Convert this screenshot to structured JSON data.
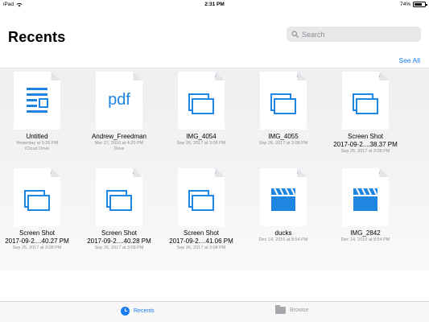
{
  "status_bar": {
    "device": "iPad",
    "time": "2:31 PM",
    "battery": "74%",
    "battery_level": 0.74
  },
  "header": {
    "title": "Recents",
    "search_placeholder": "Search",
    "see_all": "See All"
  },
  "colors": {
    "accent": "#1a7cf4",
    "icon_blue": "#1e86e0",
    "meta_gray": "#8e8e93"
  },
  "files": [
    {
      "name": "Untitled",
      "meta": "Yesterday at 5:26 PM",
      "meta2": "iCloud Drive",
      "icon": "document-icon",
      "cloud": false
    },
    {
      "name": "Andrew_Freedman",
      "meta": "Mar 27, 2016 at 4:20 PM",
      "meta2": "Drive",
      "icon": "pdf-icon",
      "pdf_label": "pdf",
      "cloud": false
    },
    {
      "name": "IMG_4054",
      "meta": "Sep 26, 2017 at 3:08 PM",
      "meta2": "",
      "icon": "image-stack-icon",
      "cloud": true
    },
    {
      "name": "IMG_4055",
      "meta": "Sep 26, 2017 at 3:08 PM",
      "meta2": "",
      "icon": "image-stack-icon",
      "cloud": true
    },
    {
      "name": "Screen Shot",
      "name2": "2017-09-2....38.37 PM",
      "meta": "Sep 26, 2017 at 3:08 PM",
      "meta2": "",
      "icon": "image-stack-icon",
      "cloud": true
    },
    {
      "name": "Screen Shot",
      "name2": "2017-09-2....40.27 PM",
      "meta": "Sep 26, 2017 at 3:08 PM",
      "meta2": "",
      "icon": "image-stack-icon",
      "cloud": true
    },
    {
      "name": "Screen Shot",
      "name2": "2017-09-2....40.28 PM",
      "meta": "Sep 26, 2017 at 3:08 PM",
      "meta2": "",
      "icon": "image-stack-icon",
      "cloud": true
    },
    {
      "name": "Screen Shot",
      "name2": "2017-09-2....41.06 PM",
      "meta": "Sep 26, 2017 at 3:08 PM",
      "meta2": "",
      "icon": "image-stack-icon",
      "cloud": true
    },
    {
      "name": "ducks",
      "meta": "Dec 14, 2016 at 8:54 PM",
      "meta2": "",
      "icon": "clapperboard-icon",
      "cloud": true
    },
    {
      "name": "IMG_2842",
      "meta": "Dec 14, 2016 at 8:54 PM",
      "meta2": "",
      "icon": "clapperboard-icon",
      "cloud": true
    }
  ],
  "tabs": [
    {
      "label": "Recents",
      "icon": "clock-icon",
      "selected": true
    },
    {
      "label": "Browse",
      "icon": "folder-icon",
      "selected": false
    }
  ]
}
